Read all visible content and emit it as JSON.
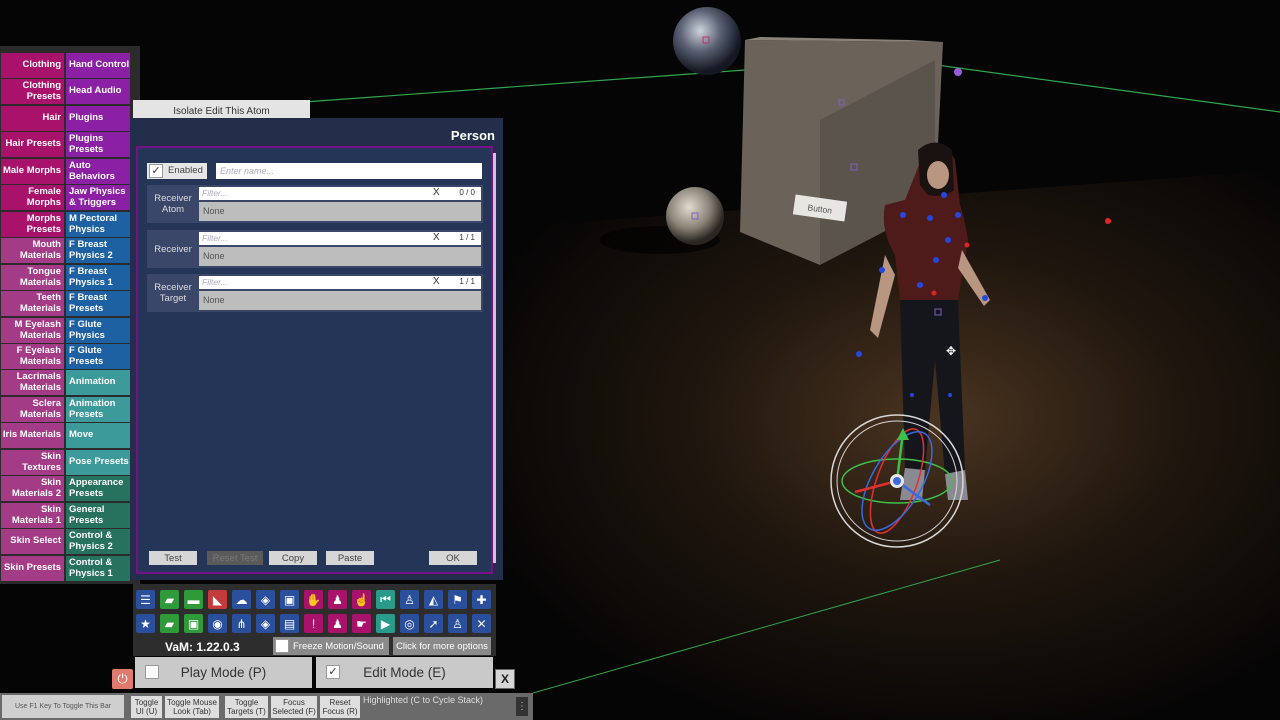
{
  "scene": {
    "button_label": "Button"
  },
  "categories": {
    "left": [
      {
        "label": "Clothing",
        "color": "#a8126a"
      },
      {
        "label": "Clothing Presets",
        "color": "#a8126a"
      },
      {
        "label": "Hair",
        "color": "#a8126a"
      },
      {
        "label": "Hair Presets",
        "color": "#a8126a"
      },
      {
        "label": "Male Morphs",
        "color": "#a8126a"
      },
      {
        "label": "Female Morphs",
        "color": "#a8126a"
      },
      {
        "label": "Morphs Presets",
        "color": "#a8126a"
      },
      {
        "label": "Mouth Materials",
        "color": "#a33b86"
      },
      {
        "label": "Tongue Materials",
        "color": "#a33b86"
      },
      {
        "label": "Teeth Materials",
        "color": "#a33b86"
      },
      {
        "label": "M Eyelash Materials",
        "color": "#a33b86"
      },
      {
        "label": "F Eyelash Materials",
        "color": "#a33b86"
      },
      {
        "label": "Lacrimals Materials",
        "color": "#a33b86"
      },
      {
        "label": "Sclera Materials",
        "color": "#a33b86"
      },
      {
        "label": "Iris Materials",
        "color": "#a33b86"
      },
      {
        "label": "Skin Textures",
        "color": "#a33b86"
      },
      {
        "label": "Skin Materials 2",
        "color": "#a33b86"
      },
      {
        "label": "Skin Materials 1",
        "color": "#a33b86"
      },
      {
        "label": "Skin Select",
        "color": "#a33b86"
      },
      {
        "label": "Skin Presets",
        "color": "#a33b86"
      }
    ],
    "right": [
      {
        "label": "Hand Control",
        "color": "#8c20a4"
      },
      {
        "label": "Head Audio",
        "color": "#8c20a4"
      },
      {
        "label": "Plugins",
        "color": "#8c20a4"
      },
      {
        "label": "Plugins Presets",
        "color": "#8c20a4"
      },
      {
        "label": "Auto Behaviors",
        "color": "#8c20a4"
      },
      {
        "label": "Jaw Physics & Triggers",
        "color": "#8c20a4"
      },
      {
        "label": "M Pectoral Physics",
        "color": "#1d61a3"
      },
      {
        "label": "F Breast Physics 2",
        "color": "#1d61a3"
      },
      {
        "label": "F Breast Physics 1",
        "color": "#1d61a3"
      },
      {
        "label": "F Breast Presets",
        "color": "#1d61a3"
      },
      {
        "label": "F Glute Physics",
        "color": "#1d61a3"
      },
      {
        "label": "F Glute Presets",
        "color": "#1d61a3"
      },
      {
        "label": "Animation",
        "color": "#3d9a9a"
      },
      {
        "label": "Animation Presets",
        "color": "#3d9a9a"
      },
      {
        "label": "Move",
        "color": "#3d9a9a"
      },
      {
        "label": "Pose Presets",
        "color": "#3d9a9a"
      },
      {
        "label": "Appearance Presets",
        "color": "#27725f"
      },
      {
        "label": "General Presets",
        "color": "#27725f"
      },
      {
        "label": "Control & Physics 2",
        "color": "#27725f"
      },
      {
        "label": "Control & Physics 1",
        "color": "#27725f"
      }
    ]
  },
  "panel": {
    "isolate_label": "Isolate Edit This Atom",
    "title": "Person",
    "enabled_label": "Enabled",
    "name_placeholder": "Enter name...",
    "receivers": [
      {
        "label": "Receiver Atom",
        "filter_placeholder": "Filter...",
        "count": "0 / 0",
        "value": "None"
      },
      {
        "label": "Receiver",
        "filter_placeholder": "Filter...",
        "count": "1 / 1",
        "value": "None"
      },
      {
        "label": "Receiver Target",
        "filter_placeholder": "Filter...",
        "count": "1 / 1",
        "value": "None"
      }
    ],
    "clear_symbol": "X",
    "buttons": {
      "test": "Test",
      "reset_test": "Reset Test",
      "copy": "Copy",
      "paste": "Paste",
      "ok": "OK"
    }
  },
  "toolbar": {
    "row1": [
      {
        "icon": "menu-icon",
        "glyph": "☰",
        "color": "#2a4f9c"
      },
      {
        "icon": "open-scene-icon",
        "glyph": "▰",
        "color": "#2f9a3a"
      },
      {
        "icon": "folder-icon",
        "glyph": "▬",
        "color": "#2f9a3a"
      },
      {
        "icon": "save-icon",
        "glyph": "◣",
        "color": "#c43b3b"
      },
      {
        "icon": "cloud-download-icon",
        "glyph": "☁",
        "color": "#2a4f9c"
      },
      {
        "icon": "box-icon",
        "glyph": "◈",
        "color": "#2a4f9c"
      },
      {
        "icon": "package-icon",
        "glyph": "▣",
        "color": "#2a4f9c"
      },
      {
        "icon": "hand-icon",
        "glyph": "✋",
        "color": "#a8126a"
      },
      {
        "icon": "person-gear-icon",
        "glyph": "♟",
        "color": "#a8126a"
      },
      {
        "icon": "touch-icon",
        "glyph": "☝",
        "color": "#a8126a"
      },
      {
        "icon": "skip-start-icon",
        "glyph": "⏮",
        "color": "#2a9a8a"
      },
      {
        "icon": "person-icon",
        "glyph": "♙",
        "color": "#2a4f9c"
      },
      {
        "icon": "unity-icon",
        "glyph": "◭",
        "color": "#2a4f9c"
      },
      {
        "icon": "flag-icon",
        "glyph": "⚑",
        "color": "#2a4f9c"
      },
      {
        "icon": "add-icon",
        "glyph": "✚",
        "color": "#2a4f9c"
      }
    ],
    "row2": [
      {
        "icon": "star-icon",
        "glyph": "★",
        "color": "#2a4f9c"
      },
      {
        "icon": "scene-icon",
        "glyph": "▰",
        "color": "#2f9a3a"
      },
      {
        "icon": "image-folder-icon",
        "glyph": "▣",
        "color": "#2f9a3a"
      },
      {
        "icon": "camera-icon",
        "glyph": "◉",
        "color": "#2a4f9c"
      },
      {
        "icon": "network-icon",
        "glyph": "⋔",
        "color": "#2a4f9c"
      },
      {
        "icon": "box-open-icon",
        "glyph": "◈",
        "color": "#2a4f9c"
      },
      {
        "icon": "document-icon",
        "glyph": "▤",
        "color": "#2a4f9c"
      },
      {
        "icon": "alert-icon",
        "glyph": "!",
        "color": "#a8126a"
      },
      {
        "icon": "user-edit-icon",
        "glyph": "♟",
        "color": "#a8126a"
      },
      {
        "icon": "grab-icon",
        "glyph": "☛",
        "color": "#a8126a"
      },
      {
        "icon": "play-icon",
        "glyph": "▶",
        "color": "#2a9a8a"
      },
      {
        "icon": "target-icon",
        "glyph": "◎",
        "color": "#2a4f9c"
      },
      {
        "icon": "cursor-icon",
        "glyph": "➚",
        "color": "#2a4f9c"
      },
      {
        "icon": "users-icon",
        "glyph": "♙",
        "color": "#2a4f9c"
      },
      {
        "icon": "tools-icon",
        "glyph": "✕",
        "color": "#2a4f9c"
      }
    ],
    "version": "VaM: 1.22.0.3",
    "freeze_label": "Freeze Motion/Sound",
    "more_label": "Click for more options"
  },
  "modes": {
    "play_label": "Play Mode (P)",
    "edit_label": "Edit Mode (E)",
    "close_label": "X"
  },
  "bottombar": {
    "hint": "Use F1 Key To Toggle This Bar",
    "buttons": [
      "Toggle UI (U)",
      "Toggle Mouse Look (Tab)",
      "Toggle Targets (T)",
      "Focus Selected (F)",
      "Reset Focus (R)"
    ],
    "status": "Highlighted (C to Cycle Stack)",
    "menu_glyph": "⋮"
  }
}
